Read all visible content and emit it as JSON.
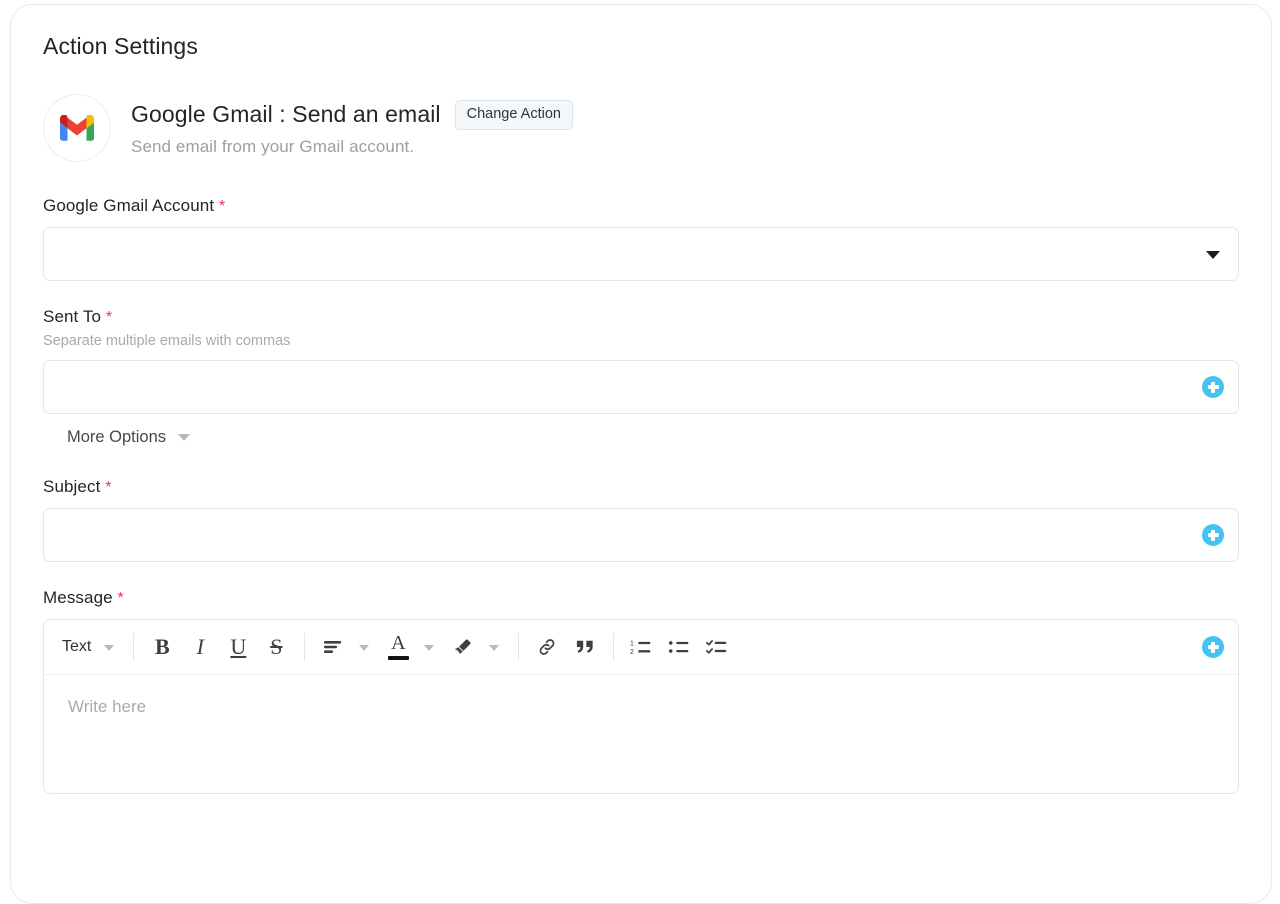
{
  "page": {
    "title": "Action Settings"
  },
  "action": {
    "icon": "gmail-logo-icon",
    "title": "Google Gmail : Send an email",
    "description": "Send email from your Gmail account.",
    "change_action_label": "Change Action"
  },
  "fields": {
    "account": {
      "label": "Google Gmail Account",
      "required_marker": "*",
      "value": "",
      "placeholder": ""
    },
    "sent_to": {
      "label": "Sent To",
      "required_marker": "*",
      "hint": "Separate multiple emails with commas",
      "value": "",
      "placeholder": "",
      "more_options_label": "More Options"
    },
    "subject": {
      "label": "Subject",
      "required_marker": "*",
      "value": "",
      "placeholder": ""
    },
    "message": {
      "label": "Message",
      "required_marker": "*",
      "placeholder": "Write here",
      "value": ""
    }
  },
  "toolbar": {
    "style_label": "Text",
    "bold": "B",
    "italic": "I",
    "underline": "U",
    "strikethrough": "S",
    "text_color_letter": "A",
    "quote_glyph": "“"
  },
  "colors": {
    "accent_plus": "#45c2ef",
    "required_red": "#e8384f",
    "button_bg": "#f4f8fb",
    "button_border": "#d6e7f3",
    "border": "#e4e6e8",
    "text": "#22262a",
    "muted": "#9aa0a6"
  }
}
